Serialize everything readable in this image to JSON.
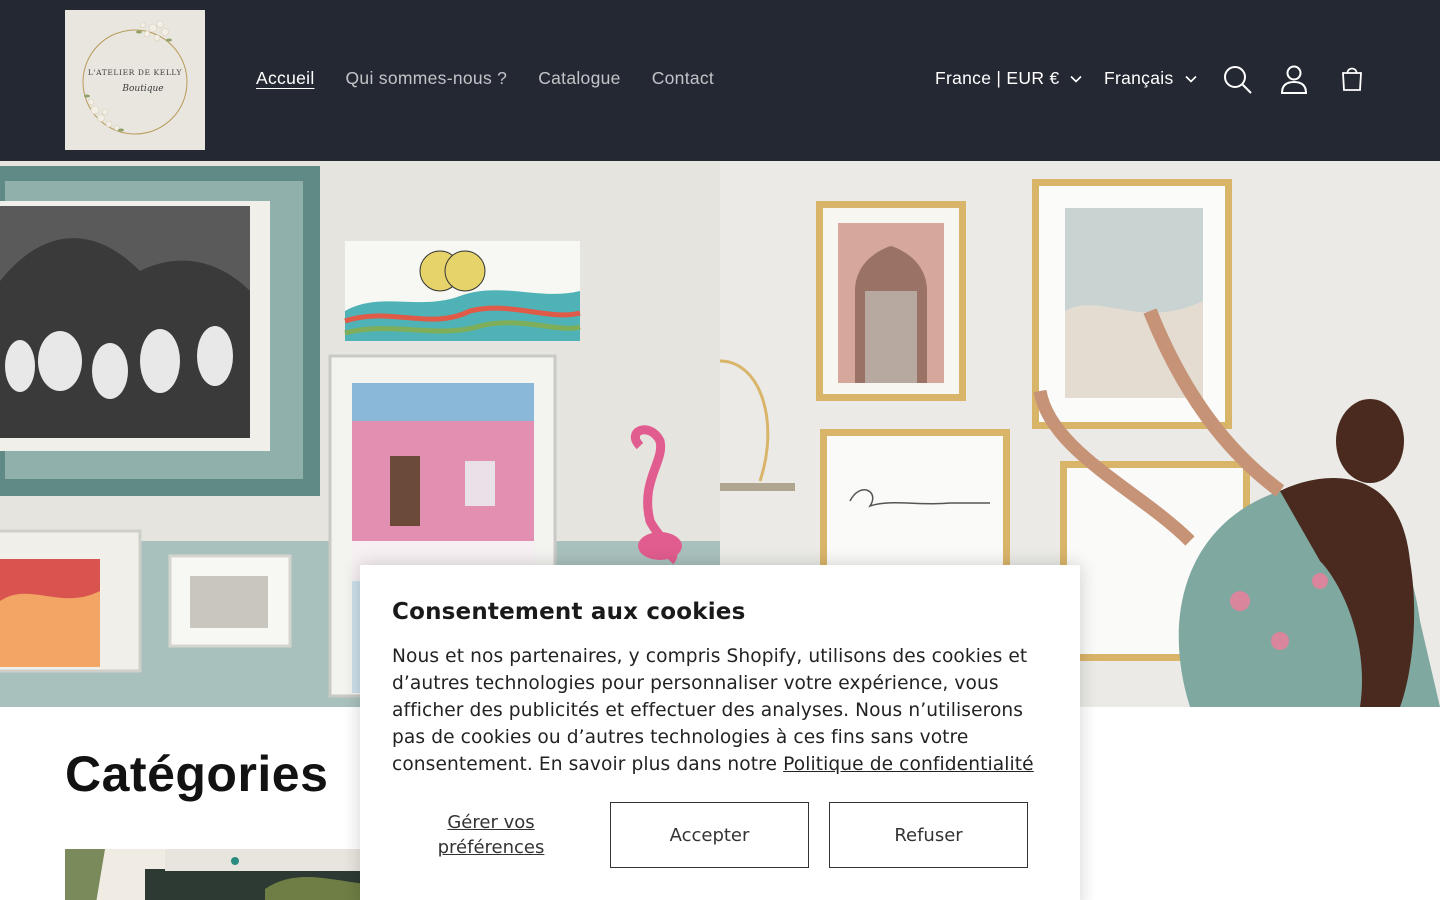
{
  "header": {
    "logo": {
      "line1": "L'ATELIER DE KELLY",
      "line2": "Boutique"
    },
    "nav": [
      {
        "label": "Accueil",
        "active": true
      },
      {
        "label": "Qui sommes-nous ?",
        "active": false
      },
      {
        "label": "Catalogue",
        "active": false
      },
      {
        "label": "Contact",
        "active": false
      }
    ],
    "country_selector": "France | EUR €",
    "language_selector": "Français",
    "icons": [
      "search-icon",
      "account-icon",
      "cart-icon"
    ],
    "background_color": "#242833"
  },
  "categories": {
    "title": "Catégories"
  },
  "cookie_banner": {
    "title": "Consentement aux cookies",
    "body": "Nous et nos partenaires, y compris Shopify, utilisons des cookies et d’autres technologies pour personnaliser votre expérience, vous afficher des publicités et effectuer des analyses. Nous n’utiliserons pas de cookies ou d’autres technologies à ces fins sans votre consentement. En savoir plus dans notre ",
    "privacy_link": "Politique de confidentialité",
    "manage_prefs": "Gérer vos préférences",
    "accept": "Accepter",
    "refuse": "Refuser"
  }
}
